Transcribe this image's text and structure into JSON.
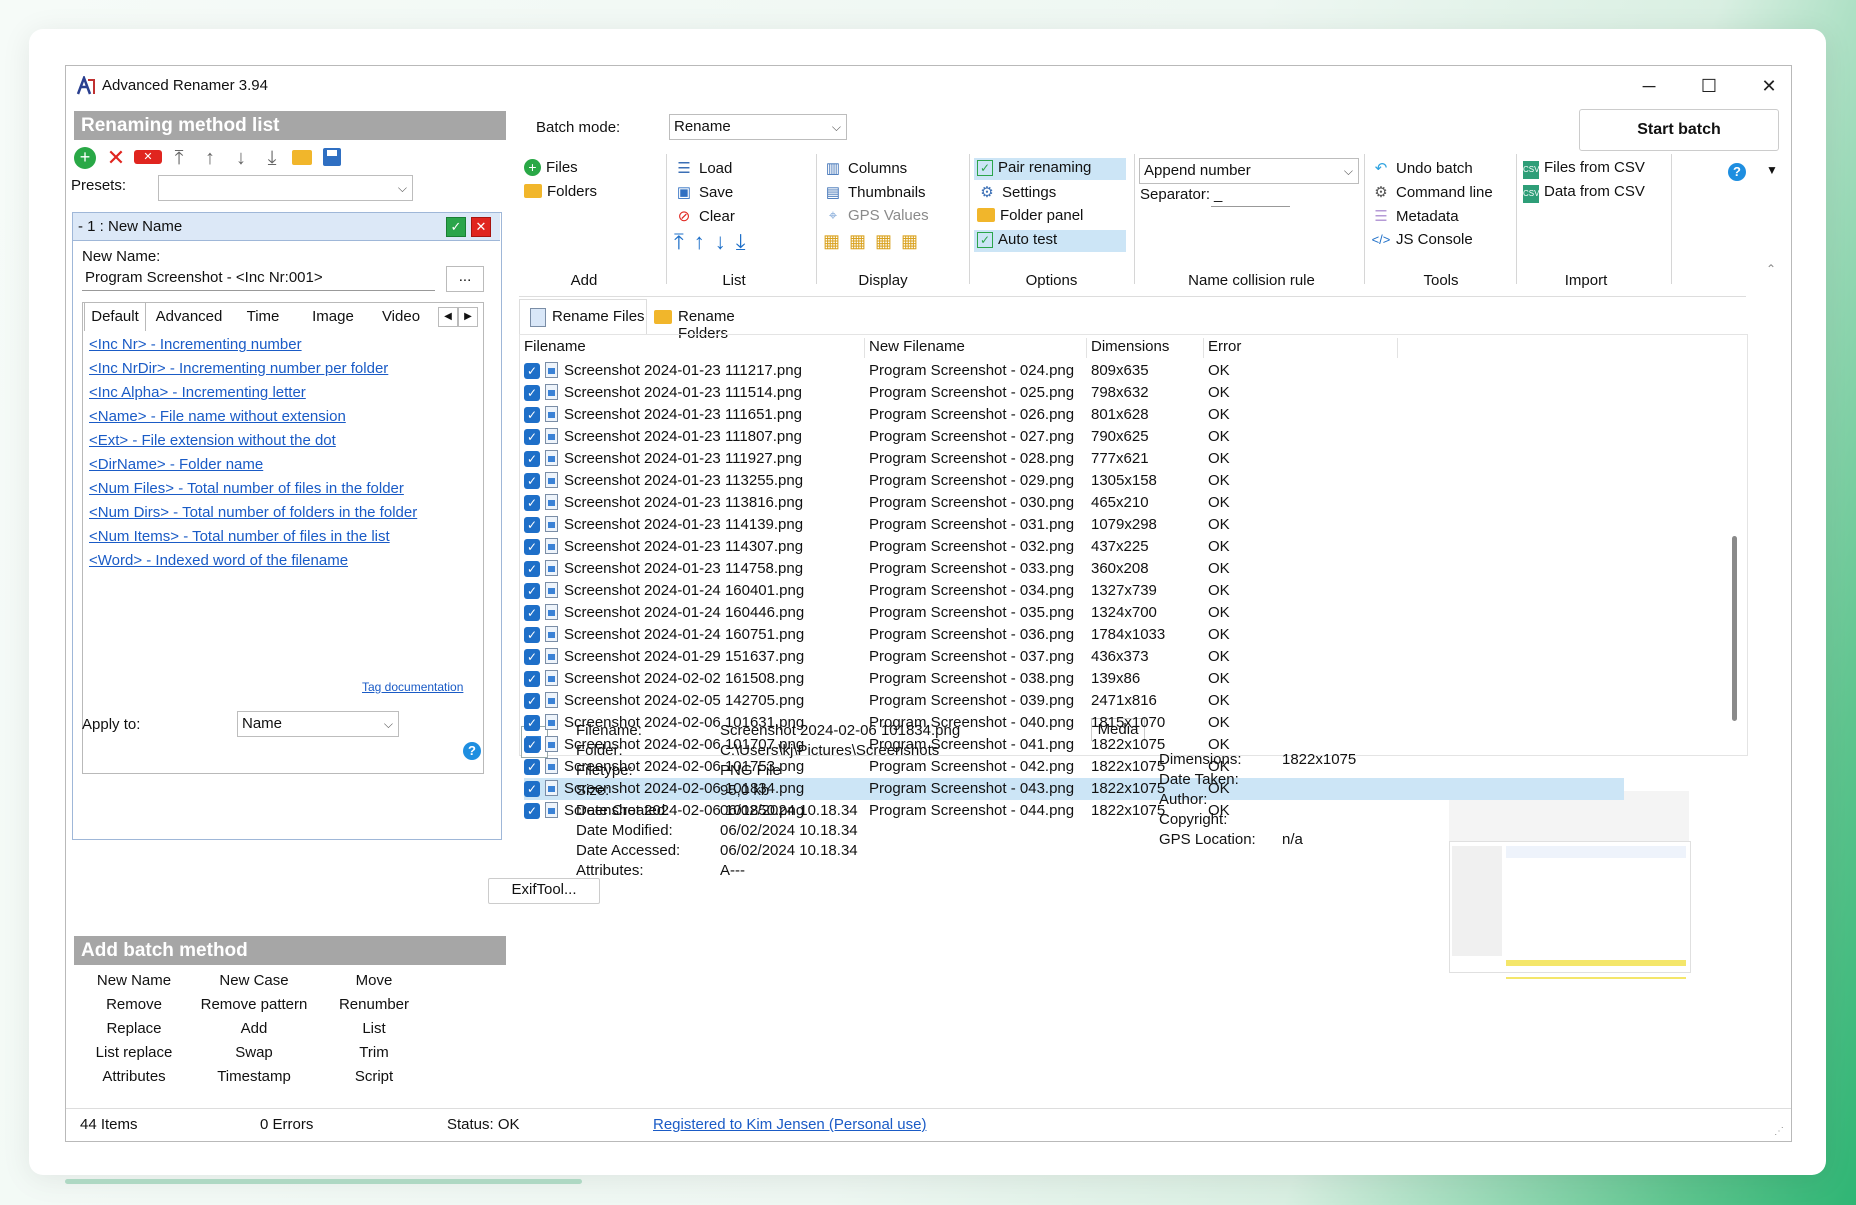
{
  "window": {
    "title": "Advanced Renamer 3.94",
    "min": "─",
    "max": "☐",
    "close": "✕"
  },
  "left": {
    "method_list_title": "Renaming method list",
    "presets_label": "Presets:",
    "presets_value": "",
    "method_header": "-   1 : New Name",
    "new_name_label": "New Name:",
    "new_name_value": "Program Screenshot - <Inc Nr:001>",
    "browse": "...",
    "tabs": [
      "Default",
      "Advanced",
      "Time",
      "Image",
      "Video"
    ],
    "tags": [
      "<Inc Nr> - Incrementing number",
      "<Inc NrDir> - Incrementing number per folder",
      "<Inc Alpha> - Incrementing letter",
      "<Name> - File name without extension",
      "<Ext> - File extension without the dot",
      "<DirName> - Folder name",
      "<Num Files> - Total number of files in the folder",
      "<Num Dirs> - Total number of folders in the folder",
      "<Num Items> - Total number of files in the list",
      "<Word> - Indexed word of the filename"
    ],
    "tag_doc": "Tag documentation",
    "apply_label": "Apply to:",
    "apply_value": "Name",
    "add_batch_title": "Add batch method",
    "batch_methods": [
      [
        "New Name",
        "New Case",
        "Move"
      ],
      [
        "Remove",
        "Remove pattern",
        "Renumber"
      ],
      [
        "Replace",
        "Add",
        "List"
      ],
      [
        "List replace",
        "Swap",
        "Trim"
      ],
      [
        "Attributes",
        "Timestamp",
        "Script"
      ]
    ]
  },
  "ribbon": {
    "batch_mode_label": "Batch mode:",
    "batch_mode_value": "Rename",
    "start_batch": "Start batch",
    "add": {
      "label": "Add",
      "files": "Files",
      "folders": "Folders"
    },
    "list": {
      "label": "List",
      "load": "Load",
      "save": "Save",
      "clear": "Clear"
    },
    "display": {
      "label": "Display",
      "columns": "Columns",
      "thumbnails": "Thumbnails",
      "gps": "GPS Values"
    },
    "options": {
      "label": "Options",
      "pair": "Pair renaming",
      "settings": "Settings",
      "folder_panel": "Folder panel",
      "auto_test": "Auto test"
    },
    "collision": {
      "label": "Name collision rule",
      "value": "Append number",
      "separator_label": "Separator:",
      "separator_value": "_"
    },
    "tools": {
      "label": "Tools",
      "undo": "Undo batch",
      "cmd": "Command line",
      "meta": "Metadata",
      "js": "JS Console"
    },
    "import": {
      "label": "Import",
      "files_csv": "Files from CSV",
      "data_csv": "Data from CSV"
    }
  },
  "file_tabs": {
    "rename_files": "Rename Files",
    "rename_folders": "Rename Folders"
  },
  "columns": [
    "Filename",
    "New Filename",
    "Dimensions",
    "Error"
  ],
  "rows": [
    [
      "Screenshot 2024-01-23 111217.png",
      "Program Screenshot - 024.png",
      "809x635",
      "OK"
    ],
    [
      "Screenshot 2024-01-23 111514.png",
      "Program Screenshot - 025.png",
      "798x632",
      "OK"
    ],
    [
      "Screenshot 2024-01-23 111651.png",
      "Program Screenshot - 026.png",
      "801x628",
      "OK"
    ],
    [
      "Screenshot 2024-01-23 111807.png",
      "Program Screenshot - 027.png",
      "790x625",
      "OK"
    ],
    [
      "Screenshot 2024-01-23 111927.png",
      "Program Screenshot - 028.png",
      "777x621",
      "OK"
    ],
    [
      "Screenshot 2024-01-23 113255.png",
      "Program Screenshot - 029.png",
      "1305x158",
      "OK"
    ],
    [
      "Screenshot 2024-01-23 113816.png",
      "Program Screenshot - 030.png",
      "465x210",
      "OK"
    ],
    [
      "Screenshot 2024-01-23 114139.png",
      "Program Screenshot - 031.png",
      "1079x298",
      "OK"
    ],
    [
      "Screenshot 2024-01-23 114307.png",
      "Program Screenshot - 032.png",
      "437x225",
      "OK"
    ],
    [
      "Screenshot 2024-01-23 114758.png",
      "Program Screenshot - 033.png",
      "360x208",
      "OK"
    ],
    [
      "Screenshot 2024-01-24 160401.png",
      "Program Screenshot - 034.png",
      "1327x739",
      "OK"
    ],
    [
      "Screenshot 2024-01-24 160446.png",
      "Program Screenshot - 035.png",
      "1324x700",
      "OK"
    ],
    [
      "Screenshot 2024-01-24 160751.png",
      "Program Screenshot - 036.png",
      "1784x1033",
      "OK"
    ],
    [
      "Screenshot 2024-01-29 151637.png",
      "Program Screenshot - 037.png",
      "436x373",
      "OK"
    ],
    [
      "Screenshot 2024-02-02 161508.png",
      "Program Screenshot - 038.png",
      "139x86",
      "OK"
    ],
    [
      "Screenshot 2024-02-05 142705.png",
      "Program Screenshot - 039.png",
      "2471x816",
      "OK"
    ],
    [
      "Screenshot 2024-02-06 101631.png",
      "Program Screenshot - 040.png",
      "1815x1070",
      "OK"
    ],
    [
      "Screenshot 2024-02-06 101707.png",
      "Program Screenshot - 041.png",
      "1822x1075",
      "OK"
    ],
    [
      "Screenshot 2024-02-06 101753.png",
      "Program Screenshot - 042.png",
      "1822x1075",
      "OK"
    ],
    [
      "Screenshot 2024-02-06 101834.png",
      "Program Screenshot - 043.png",
      "1822x1075",
      "OK"
    ],
    [
      "Screenshot 2024-02-06 101850.png",
      "Program Screenshot - 044.png",
      "1822x1075",
      "OK"
    ]
  ],
  "selected_row": 19,
  "details": {
    "labels": [
      "Filename:",
      "Folder:",
      "Filetype:",
      "Size:",
      "Date Created:",
      "Date Modified:",
      "Date Accessed:",
      "Attributes:"
    ],
    "values": [
      "Screenshot 2024-02-06 101834.png",
      "C:\\Users\\kj\\Pictures\\Screenshots",
      "PNG File",
      "95,0 kb",
      "06/02/2024 10.18.34",
      "06/02/2024 10.18.34",
      "06/02/2024 10.18.34",
      "A---"
    ],
    "exiftool": "ExifTool...",
    "media_tab": "Media",
    "media_labels": [
      "Dimensions:",
      "Date Taken:",
      "Author:",
      "Copyright:",
      "GPS Location:"
    ],
    "media_values": [
      "1822x1075",
      "",
      "",
      "",
      "n/a"
    ]
  },
  "status": {
    "items": "44 Items",
    "errors": "0 Errors",
    "status": "Status: OK",
    "registered": "Registered to Kim Jensen (Personal use)"
  },
  "colors": {
    "accent": "#1e6fc8",
    "link": "#1a5bc6",
    "header_gray": "#a6a6a6",
    "selected_row": "#cce5f6",
    "method_header": "#dce8f7"
  }
}
